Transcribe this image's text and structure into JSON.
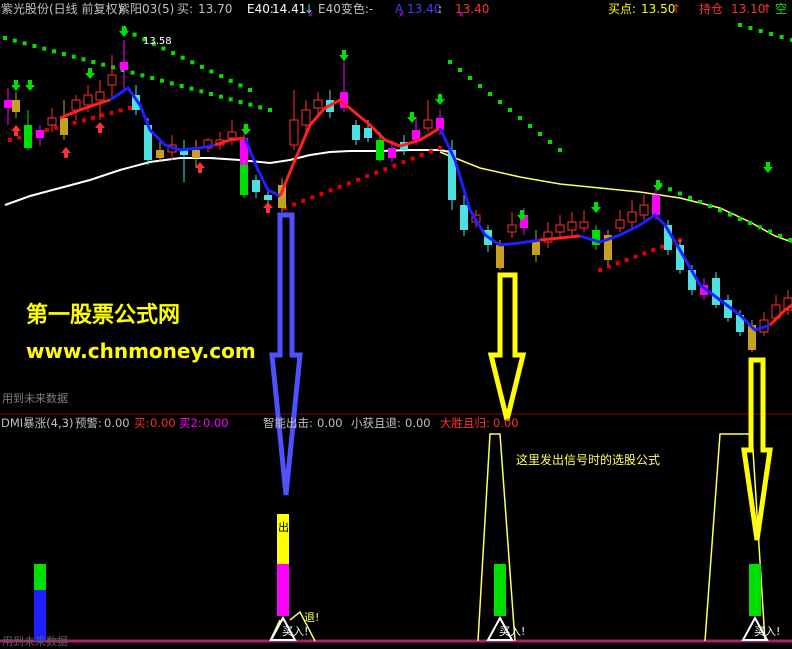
{
  "header": {
    "stock_title": "紫光股份(日线 前复权)",
    "indicator_name": "紫阳03(5)",
    "buy_label": "买:",
    "buy_value": "13.70",
    "e40_label": "E40:",
    "e40_value": "14.41",
    "e40_color_label": "E40变色:",
    "e40_color_value": "-",
    "a_label": "A",
    "a_value": "13.40",
    "d_value": "13.40",
    "buy_point_label": "买点:",
    "buy_point_value": "13.50",
    "hold_label": "持仓",
    "hold_value": "13.10",
    "empty_label": "空"
  },
  "main_chart": {
    "price_marker": "13.58",
    "watermark_title": "第一股票公式网",
    "watermark_url": "www.chnmoney.com",
    "future_data_note": "用到未来数据"
  },
  "sub_panel": {
    "indicator": "DMI暴涨(4,3)",
    "warning_label": "预警:",
    "warning_value": "0.00",
    "buy_label": "买:",
    "buy_value": "0.00",
    "buy2_label": "买2:",
    "buy2_value": "0.00",
    "smart_label": "智能出击:",
    "smart_value": "0.00",
    "small_gain_label": "小获且退:",
    "small_gain_value": "0.00",
    "big_win_label": "大胜且归:",
    "big_win_value": "0.00",
    "annotation": "这里发出信号时的选股公式",
    "attack_label": "出攻!",
    "retreat_label": "退!",
    "buy_signal_label": "买入!",
    "future_data_note": "用到未来数据"
  },
  "colors": {
    "background": "#000000",
    "up": "#ff3030",
    "down": "#4de0e0",
    "ma_white": "#ffffff",
    "ma_yellow": "#ffff60",
    "dots_green": "#00e000",
    "dots_red": "#e00000",
    "signal_yellow": "#ffff00",
    "arrow_blue": "#4040ff",
    "watermark": "#ffff00"
  }
}
